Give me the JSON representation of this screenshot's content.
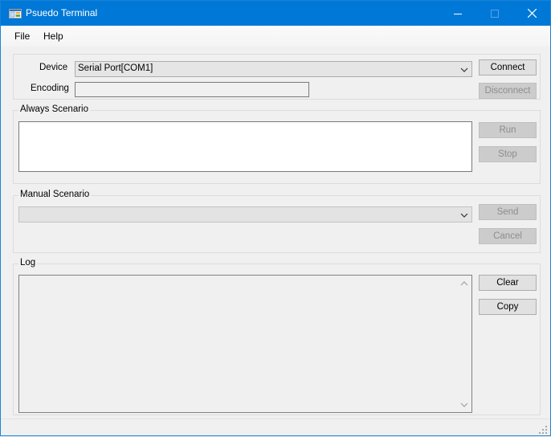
{
  "window": {
    "title": "Psuedo Terminal"
  },
  "menu": {
    "file": "File",
    "help": "Help"
  },
  "device_group": {
    "device_label": "Device",
    "device_value": "Serial Port[COM1]",
    "encoding_label": "Encoding",
    "encoding_value": "",
    "connect_label": "Connect",
    "disconnect_label": "Disconnect"
  },
  "always_scenario": {
    "title": "Always Scenario",
    "content": "",
    "run_label": "Run",
    "stop_label": "Stop"
  },
  "manual_scenario": {
    "title": "Manual Scenario",
    "selected": "",
    "send_label": "Send",
    "cancel_label": "Cancel"
  },
  "log": {
    "title": "Log",
    "content": "",
    "clear_label": "Clear",
    "copy_label": "Copy"
  },
  "icons": {
    "app": "terminal-app-icon",
    "minimize": "minimize-icon",
    "maximize": "maximize-icon",
    "close": "close-icon",
    "dropdown": "chevron-down-icon",
    "scroll_up": "chevron-up-icon",
    "scroll_down": "chevron-down-icon",
    "grip": "resize-grip-icon"
  },
  "colors": {
    "titlebar": "#0078d7",
    "window_bg": "#f0f0f0",
    "disabled_button_bg": "#cccccc",
    "disabled_text": "#8d8d8d"
  }
}
